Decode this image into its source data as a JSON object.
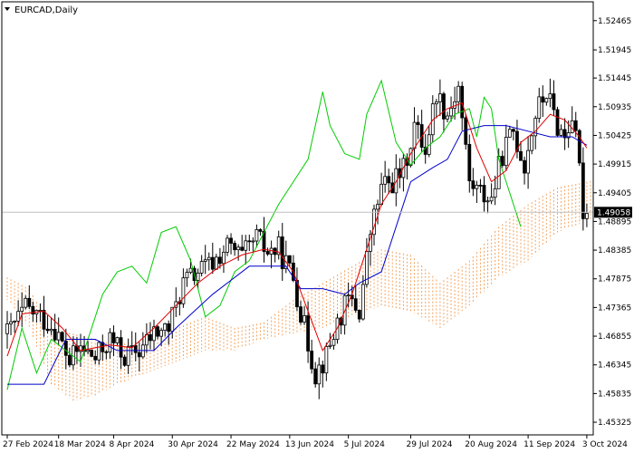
{
  "symbol_label": "EURCAD,Daily",
  "colors": {
    "background": "#ffffff",
    "axis": "#000000",
    "tenkan": "#e00000",
    "kijun": "#0000cc",
    "chikou": "#00cc00",
    "cloud_bull": "#f4a460",
    "cloud_bear": "#c8a2c8",
    "candle": "#000000",
    "price_line": "#c0c0c0",
    "price_tag_bg": "#000000",
    "price_tag_text": "#ffffff"
  },
  "chart_data": {
    "type": "candlestick",
    "instrument": "EURCAD",
    "timeframe": "Daily",
    "ylim": [
      1.451,
      1.528
    ],
    "y_ticks": [
      "1.52465",
      "1.51945",
      "1.51445",
      "1.50935",
      "1.50425",
      "1.49915",
      "1.49405",
      "1.48895",
      "1.48385",
      "1.47875",
      "1.47365",
      "1.46855",
      "1.46345",
      "1.45835",
      "1.45325"
    ],
    "x_ticks": [
      {
        "label": "27 Feb 2024",
        "index": 0
      },
      {
        "label": "18 Mar 2024",
        "index": 14
      },
      {
        "label": "8 Apr 2024",
        "index": 29
      },
      {
        "label": "30 Apr 2024",
        "index": 45
      },
      {
        "label": "22 May 2024",
        "index": 61
      },
      {
        "label": "13 Jun 2024",
        "index": 77
      },
      {
        "label": "5 Jul 2024",
        "index": 93
      },
      {
        "label": "29 Jul 2024",
        "index": 110
      },
      {
        "label": "20 Aug 2024",
        "index": 126
      },
      {
        "label": "11 Sep 2024",
        "index": 142
      },
      {
        "label": "3 Oct 2024",
        "index": 158
      }
    ],
    "current_price": "1.49058",
    "close_path": [
      [
        0,
        1.469
      ],
      [
        5,
        1.4735
      ],
      [
        9,
        1.472
      ],
      [
        13,
        1.47
      ],
      [
        17,
        1.464
      ],
      [
        20,
        1.4665
      ],
      [
        24,
        1.4645
      ],
      [
        28,
        1.468
      ],
      [
        32,
        1.465
      ],
      [
        36,
        1.466
      ],
      [
        40,
        1.469
      ],
      [
        44,
        1.47
      ],
      [
        48,
        1.478
      ],
      [
        52,
        1.48
      ],
      [
        56,
        1.4815
      ],
      [
        60,
        1.4845
      ],
      [
        64,
        1.4825
      ],
      [
        68,
        1.486
      ],
      [
        71,
        1.4835
      ],
      [
        74,
        1.484
      ],
      [
        78,
        1.479
      ],
      [
        81,
        1.47
      ],
      [
        84,
        1.462
      ],
      [
        87,
        1.465
      ],
      [
        90,
        1.471
      ],
      [
        93,
        1.475
      ],
      [
        96,
        1.473
      ],
      [
        99,
        1.487
      ],
      [
        102,
        1.495
      ],
      [
        105,
        1.496
      ],
      [
        108,
        1.498
      ],
      [
        111,
        1.506
      ],
      [
        114,
        1.502
      ],
      [
        117,
        1.512
      ],
      [
        120,
        1.508
      ],
      [
        123,
        1.513
      ],
      [
        126,
        1.496
      ],
      [
        129,
        1.494
      ],
      [
        132,
        1.493
      ],
      [
        135,
        1.501
      ],
      [
        138,
        1.505
      ],
      [
        141,
        1.499
      ],
      [
        144,
        1.508
      ],
      [
        147,
        1.512
      ],
      [
        150,
        1.506
      ],
      [
        152,
        1.504
      ],
      [
        154,
        1.508
      ],
      [
        156,
        1.498
      ],
      [
        157,
        1.491
      ],
      [
        158,
        1.4906
      ]
    ],
    "tenkan_path": [
      [
        0,
        1.465
      ],
      [
        4,
        1.4725
      ],
      [
        10,
        1.473
      ],
      [
        15,
        1.47
      ],
      [
        20,
        1.466
      ],
      [
        28,
        1.467
      ],
      [
        34,
        1.4665
      ],
      [
        40,
        1.47
      ],
      [
        46,
        1.474
      ],
      [
        52,
        1.478
      ],
      [
        58,
        1.481
      ],
      [
        64,
        1.483
      ],
      [
        70,
        1.484
      ],
      [
        74,
        1.4835
      ],
      [
        78,
        1.48
      ],
      [
        82,
        1.473
      ],
      [
        86,
        1.466
      ],
      [
        90,
        1.47
      ],
      [
        94,
        1.476
      ],
      [
        98,
        1.484
      ],
      [
        102,
        1.492
      ],
      [
        106,
        1.496
      ],
      [
        110,
        1.501
      ],
      [
        116,
        1.507
      ],
      [
        120,
        1.509
      ],
      [
        124,
        1.51
      ],
      [
        128,
        1.502
      ],
      [
        132,
        1.496
      ],
      [
        136,
        1.498
      ],
      [
        140,
        1.503
      ],
      [
        144,
        1.505
      ],
      [
        148,
        1.508
      ],
      [
        152,
        1.507
      ],
      [
        156,
        1.504
      ],
      [
        158,
        1.502
      ]
    ],
    "kijun_path": [
      [
        0,
        1.46
      ],
      [
        10,
        1.46
      ],
      [
        16,
        1.468
      ],
      [
        24,
        1.468
      ],
      [
        30,
        1.466
      ],
      [
        40,
        1.466
      ],
      [
        46,
        1.47
      ],
      [
        56,
        1.476
      ],
      [
        66,
        1.481
      ],
      [
        76,
        1.481
      ],
      [
        80,
        1.477
      ],
      [
        86,
        1.477
      ],
      [
        92,
        1.476
      ],
      [
        96,
        1.478
      ],
      [
        102,
        1.48
      ],
      [
        106,
        1.488
      ],
      [
        110,
        1.496
      ],
      [
        116,
        1.4985
      ],
      [
        120,
        1.5
      ],
      [
        124,
        1.505
      ],
      [
        130,
        1.506
      ],
      [
        136,
        1.506
      ],
      [
        142,
        1.505
      ],
      [
        148,
        1.504
      ],
      [
        154,
        1.504
      ],
      [
        158,
        1.5025
      ]
    ],
    "chikou_path": [
      [
        0,
        1.459
      ],
      [
        4,
        1.47
      ],
      [
        8,
        1.462
      ],
      [
        12,
        1.468
      ],
      [
        16,
        1.466
      ],
      [
        20,
        1.464
      ],
      [
        26,
        1.476
      ],
      [
        30,
        1.48
      ],
      [
        34,
        1.481
      ],
      [
        38,
        1.478
      ],
      [
        42,
        1.487
      ],
      [
        46,
        1.488
      ],
      [
        50,
        1.482
      ],
      [
        54,
        1.472
      ],
      [
        58,
        1.474
      ],
      [
        62,
        1.48
      ],
      [
        66,
        1.482
      ],
      [
        70,
        1.487
      ],
      [
        74,
        1.492
      ],
      [
        78,
        1.496
      ],
      [
        82,
        1.5
      ],
      [
        86,
        1.512
      ],
      [
        88,
        1.506
      ],
      [
        92,
        1.501
      ],
      [
        96,
        1.5
      ],
      [
        98,
        1.508
      ],
      [
        102,
        1.514
      ],
      [
        106,
        1.503
      ],
      [
        110,
        1.499
      ],
      [
        114,
        1.502
      ],
      [
        118,
        1.504
      ],
      [
        122,
        1.508
      ],
      [
        126,
        1.509
      ],
      [
        128,
        1.504
      ],
      [
        130,
        1.511
      ],
      [
        132,
        1.509
      ],
      [
        134,
        1.5
      ],
      [
        136,
        1.496
      ],
      [
        138,
        1.492
      ],
      [
        140,
        1.488
      ]
    ],
    "senkou_a_path": [
      [
        0,
        1.479
      ],
      [
        6,
        1.477
      ],
      [
        12,
        1.47
      ],
      [
        18,
        1.469
      ],
      [
        24,
        1.468
      ],
      [
        30,
        1.467
      ],
      [
        38,
        1.468
      ],
      [
        46,
        1.47
      ],
      [
        54,
        1.472
      ],
      [
        62,
        1.47
      ],
      [
        70,
        1.471
      ],
      [
        78,
        1.475
      ],
      [
        86,
        1.478
      ],
      [
        94,
        1.481
      ],
      [
        102,
        1.484
      ],
      [
        110,
        1.483
      ],
      [
        118,
        1.478
      ],
      [
        126,
        1.482
      ],
      [
        134,
        1.488
      ],
      [
        142,
        1.492
      ],
      [
        150,
        1.495
      ],
      [
        158,
        1.496
      ],
      [
        164,
        1.497
      ]
    ],
    "senkou_b_path": [
      [
        0,
        1.475
      ],
      [
        6,
        1.47
      ],
      [
        12,
        1.46
      ],
      [
        18,
        1.457
      ],
      [
        24,
        1.458
      ],
      [
        30,
        1.46
      ],
      [
        38,
        1.462
      ],
      [
        46,
        1.464
      ],
      [
        54,
        1.466
      ],
      [
        62,
        1.466
      ],
      [
        70,
        1.468
      ],
      [
        78,
        1.469
      ],
      [
        86,
        1.47
      ],
      [
        94,
        1.472
      ],
      [
        102,
        1.474
      ],
      [
        110,
        1.473
      ],
      [
        118,
        1.47
      ],
      [
        126,
        1.474
      ],
      [
        134,
        1.479
      ],
      [
        142,
        1.482
      ],
      [
        150,
        1.487
      ],
      [
        158,
        1.489
      ],
      [
        164,
        1.49
      ]
    ]
  }
}
